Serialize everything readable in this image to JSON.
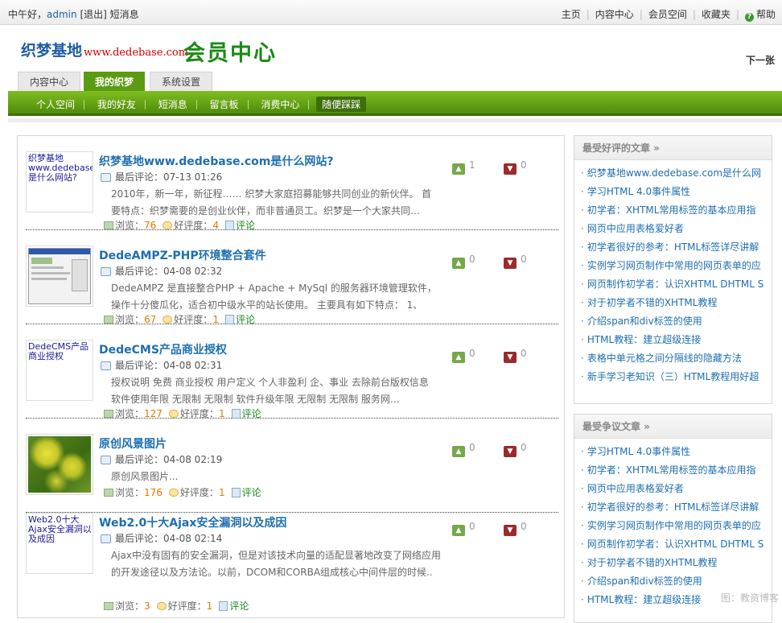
{
  "topbar": {
    "greeting": "中午好，",
    "username": "admin",
    "logout": "[退出]",
    "messages": "短消息",
    "links": [
      "主页",
      "内容中心",
      "会员空间",
      "收藏夹"
    ],
    "help": "帮助"
  },
  "header": {
    "logo_cn": "织梦基地",
    "logo_www": "www.dedebase.com",
    "title": "会员中心",
    "next_page": "下一张"
  },
  "tabs": [
    "内容中心",
    "我的织梦",
    "系统设置"
  ],
  "active_tab": "我的织梦",
  "subnav": [
    "个人空间",
    "我的好友",
    "短消息",
    "留言板",
    "消费中心",
    "随便踩踩"
  ],
  "active_subnav": "随便踩踩",
  "articles": [
    {
      "thumb_text": "织梦基地www.dedebase.com是什么网站?",
      "title": "织梦基地www.dedebase.com是什么网站?",
      "last_comment": "最后评论：07-13 01:26",
      "desc": "2010年，新一年，新征程…… 织梦大家庭招募能够共同创业的新伙伴。 首要特点：织梦需要的是创业伙伴，而非普通员工。织梦是一个大家共同…",
      "views_label": "浏览：",
      "views": "76",
      "rating_label": "好评度：",
      "rating": "4",
      "comment": "评论",
      "up": "1",
      "down": "0"
    },
    {
      "thumb_text": "",
      "title": "DedeAMPZ-PHP环境整合套件",
      "last_comment": "最后评论：04-08 02:32",
      "desc": "DedeAMPZ 是直接整合PHP + Apache + MySql 的服务器环境管理软件，操作十分傻瓜化，适合初中级水平的站长使用。 主要具有如下特点： 1、支…",
      "views_label": "浏览：",
      "views": "67",
      "rating_label": "好评度：",
      "rating": "1",
      "comment": "评论",
      "up": "0",
      "down": "0"
    },
    {
      "thumb_text": "DedeCMS产品商业授权",
      "title": "DedeCMS产品商业授权",
      "last_comment": "最后评论：04-08 02:31",
      "desc": "授权说明 免费 商业授权 用户定义 个人非盈利 企、事业 去除前台版权信息 软件使用年限 无限制 无限制 软件升级年限 无限制 无限制 服务网…",
      "views_label": "浏览：",
      "views": "127",
      "rating_label": "好评度：",
      "rating": "1",
      "comment": "评论",
      "up": "0",
      "down": "0"
    },
    {
      "thumb_text": "",
      "title": "原创风景图片",
      "last_comment": "最后评论：04-08 02:19",
      "desc": "原创风景图片...",
      "views_label": "浏览：",
      "views": "176",
      "rating_label": "好评度：",
      "rating": "1",
      "comment": "评论",
      "up": "0",
      "down": "0"
    },
    {
      "thumb_text": "Web2.0十大Ajax安全漏洞以及成因",
      "title": "Web2.0十大Ajax安全漏洞以及成因",
      "last_comment": "最后评论：04-08 02:14",
      "desc": "Ajax中没有固有的安全漏洞，但是对该技术向量的适配显著地改变了网络应用的开发途径以及方法论。以前，DCOM和CORBA组成核心中间件层的时候..",
      "views_label": "浏览：",
      "views": "3",
      "rating_label": "好评度：",
      "rating": "1",
      "comment": "评论",
      "up": "0",
      "down": "0"
    }
  ],
  "sidebar": [
    {
      "title": "最受好评的文章 »",
      "items": [
        "织梦基地www.dedebase.com是什么网",
        "学习HTML 4.0事件属性",
        "初学者：XHTML常用标签的基本应用指",
        "网页中应用表格爱好者",
        "初学者很好的参考：HTML标签详尽讲解",
        "实例学习网页制作中常用的网页表单的应",
        "网页制作初学者：认识XHTML DHTML S",
        "对于初学者不错的XHTML教程",
        "介绍span和div标签的使用",
        "HTML教程：建立超级连接",
        "表格中单元格之间分隔线的隐藏方法",
        "新手学习老知识（三）HTML教程用好超"
      ]
    },
    {
      "title": "最受争议文章 »",
      "items": [
        "学习HTML 4.0事件属性",
        "初学者：XHTML常用标签的基本应用指",
        "网页中应用表格爱好者",
        "初学者很好的参考：HTML标签详尽讲解",
        "实例学习网页制作中常用的网页表单的应",
        "网页制作初学者：认识XHTML DHTML S",
        "对于初学者不错的XHTML教程",
        "介绍span和div标签的使用",
        "HTML教程：建立超级连接"
      ]
    }
  ],
  "watermark": "图：教资博客"
}
